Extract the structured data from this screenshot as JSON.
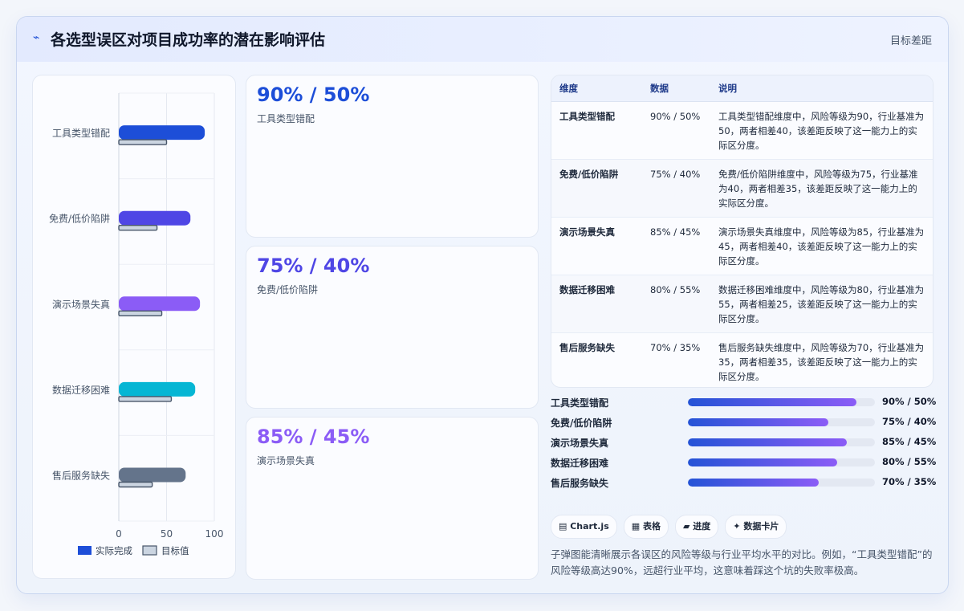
{
  "header": {
    "icon": "lightning-icon",
    "title": "各选型误区对项目成功率的潜在影响评估",
    "right_label": "目标差距"
  },
  "chart_data": {
    "type": "bar",
    "orientation": "horizontal",
    "categories": [
      "工具类型错配",
      "免费/低价陷阱",
      "演示场景失真",
      "数据迁移困难",
      "售后服务缺失"
    ],
    "series": [
      {
        "name": "实际完成",
        "values": [
          90,
          75,
          85,
          80,
          70
        ],
        "colors": [
          "#1d4ed8",
          "#4f46e5",
          "#8b5cf6",
          "#06b6d4",
          "#64748b"
        ]
      },
      {
        "name": "目标值",
        "values": [
          50,
          40,
          45,
          55,
          35
        ],
        "color": "#cbd5e1"
      }
    ],
    "xlim": [
      0,
      100
    ],
    "xticks": [
      "0",
      "50",
      "100"
    ],
    "legend_position": "bottom",
    "grid": true
  },
  "cards": [
    {
      "value": "90% / 50%",
      "label": "工具类型错配",
      "color": "#1d4ed8"
    },
    {
      "value": "75% / 40%",
      "label": "免费/低价陷阱",
      "color": "#4f46e5"
    },
    {
      "value": "85% / 45%",
      "label": "演示场景失真",
      "color": "#8b5cf6"
    }
  ],
  "table": {
    "headers": [
      "维度",
      "数据",
      "说明"
    ],
    "rows": [
      [
        "工具类型错配",
        "90% / 50%",
        "工具类型错配维度中，风险等级为90，行业基准为50，两者相差40，该差距反映了这一能力上的实际区分度。"
      ],
      [
        "免费/低价陷阱",
        "75% / 40%",
        "免费/低价陷阱维度中，风险等级为75，行业基准为40，两者相差35，该差距反映了这一能力上的实际区分度。"
      ],
      [
        "演示场景失真",
        "85% / 45%",
        "演示场景失真维度中，风险等级为85，行业基准为45，两者相差40，该差距反映了这一能力上的实际区分度。"
      ],
      [
        "数据迁移困难",
        "80% / 55%",
        "数据迁移困难维度中，风险等级为80，行业基准为55，两者相差25，该差距反映了这一能力上的实际区分度。"
      ],
      [
        "售后服务缺失",
        "70% / 35%",
        "售后服务缺失维度中，风险等级为70，行业基准为35，两者相差35，该差距反映了这一能力上的实际区分度。"
      ]
    ]
  },
  "progress": [
    {
      "label": "工具类型错配",
      "value": 90,
      "text": "90% / 50%"
    },
    {
      "label": "免费/低价陷阱",
      "value": 75,
      "text": "75% / 40%"
    },
    {
      "label": "演示场景失真",
      "value": 85,
      "text": "85% / 45%"
    },
    {
      "label": "数据迁移困难",
      "value": 80,
      "text": "80% / 55%"
    },
    {
      "label": "售后服务缺失",
      "value": 70,
      "text": "70% / 35%"
    }
  ],
  "tags": [
    {
      "icon": "document-icon",
      "label": "Chart.js"
    },
    {
      "icon": "table-icon",
      "label": "表格"
    },
    {
      "icon": "progress-icon",
      "label": "进度"
    },
    {
      "icon": "sparkle-icon",
      "label": "数据卡片"
    }
  ],
  "note": "子弹图能清晰展示各误区的风险等级与行业平均水平的对比。例如，“工具类型错配”的风险等级高达90%，远超行业平均，这意味着踩这个坑的失败率极高。"
}
